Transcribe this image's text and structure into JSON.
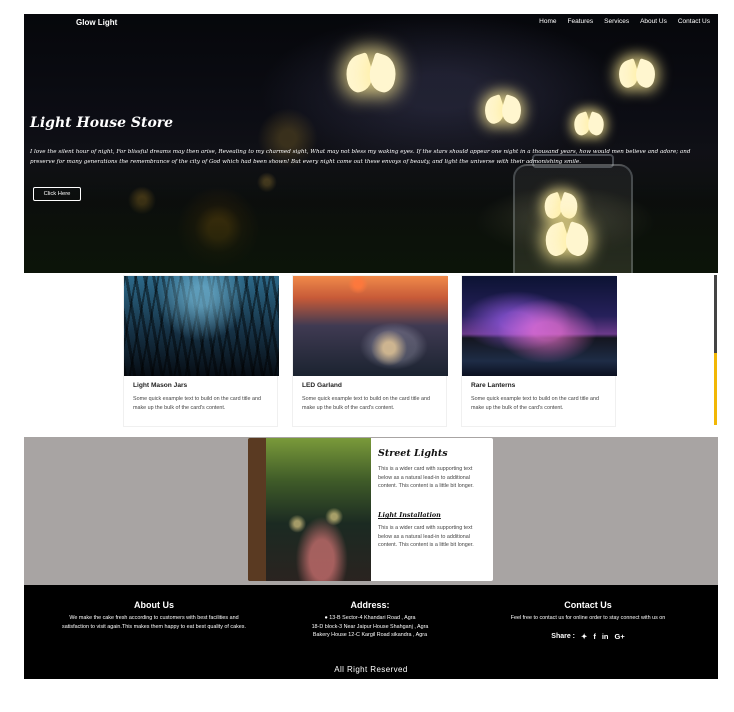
{
  "navbar": {
    "brand": "Glow Light",
    "links": [
      "Home",
      "Features",
      "Services",
      "About Us",
      "Contact Us"
    ]
  },
  "hero": {
    "title": "Light House Store",
    "text": "I love the silent hour of night, For blissful dreams may then arise, Revealing to my charmed sight, What may not bless my waking eyes. If the stars should appear one night in a thousand years, how would men believe and adore; and preserve for many generations the remembrance of the city of God which had been shown! But every night come out these envoys of beauty, and light the universe with their admonishing smile.",
    "button_label": "Click Here"
  },
  "cards": [
    {
      "title": "Light Mason Jars",
      "text": "Some quick example text to build on the card title and make up the bulk of the card's content."
    },
    {
      "title": "LED Garland",
      "text": "Some quick example text to build on the card title and make up the bulk of the card's content."
    },
    {
      "title": "Rare Lanterns",
      "text": "Some quick example text to build on the card title and make up the bulk of the card's content."
    }
  ],
  "feature": {
    "title": "Street Lights",
    "text": "This is a wider card with supporting text below as a natural lead-in to additional content. This content is a little bit longer.",
    "subtitle": "Light Installation",
    "subtext": "This is a wider card with supporting text below as a natural lead-in to additional content. This content is a little bit longer."
  },
  "footer": {
    "about": {
      "heading": "About Us",
      "text": "We make the cake fresh according to customers with best facilities and satisfaction to visit again.This makes them happy to eat best quality of cakes."
    },
    "address": {
      "heading": "Address:",
      "line1": "13-B Sector-4 Khandari Road , Agra",
      "line2": "18-D block-3 Near Jaipur House Shahganj , Agra",
      "line3": "Bakery House 12-C Kargil Road sikandra , Agra"
    },
    "contact": {
      "heading": "Contact Us",
      "text": "Feel free to contact us for online order to stay connect with us on",
      "share_label": "Share :"
    },
    "rights": "All Right Reserved"
  }
}
